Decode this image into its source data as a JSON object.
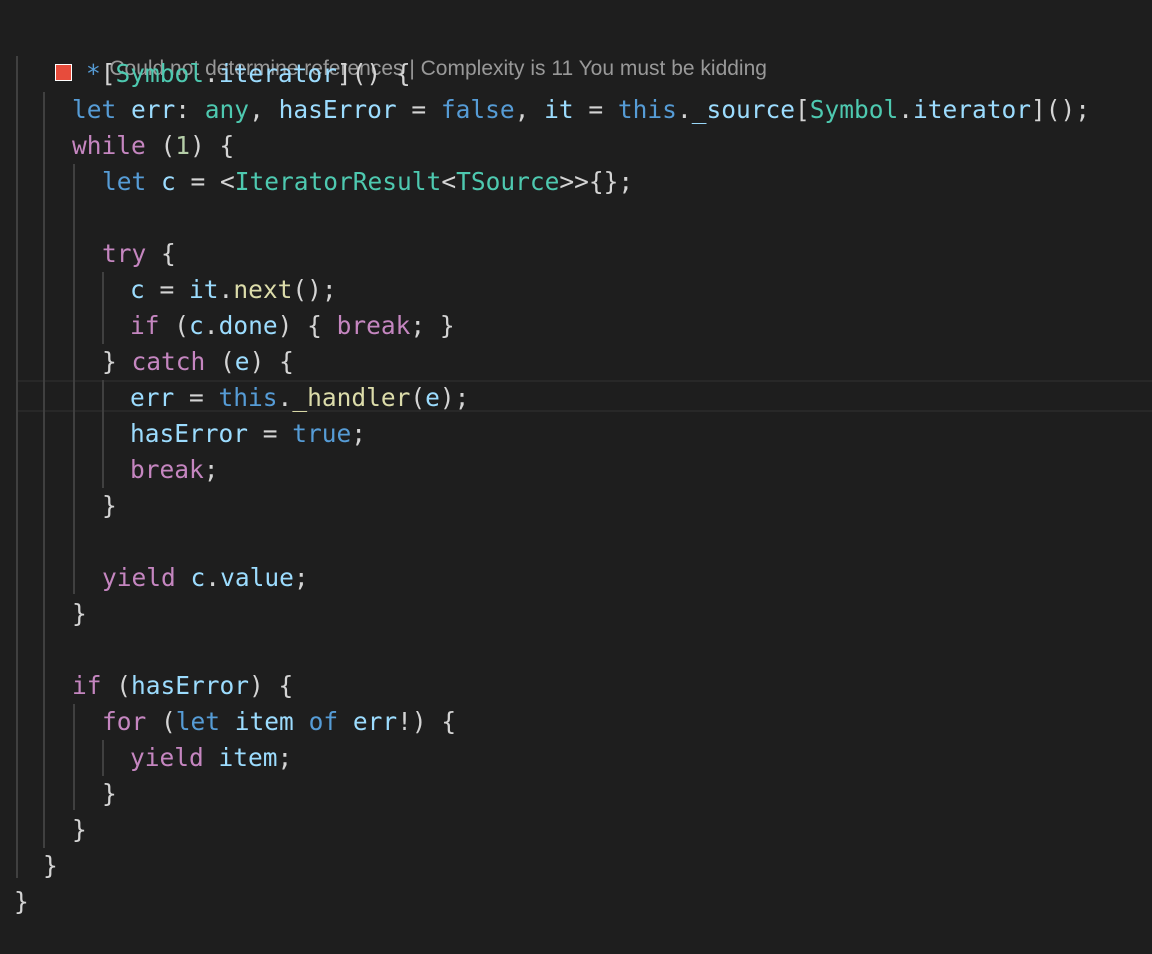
{
  "codelens": {
    "references": "Could not determine references",
    "separator": " | ",
    "complexity": "Complexity is 11 You must be kidding"
  },
  "breakpoint": {
    "color": "#e74c3c",
    "icon": "breakpoint-square"
  },
  "code_lines": [
    [
      {
        "t": "*",
        "c": "b"
      },
      {
        "t": "[",
        "c": "p"
      },
      {
        "t": "Symbol",
        "c": "t"
      },
      {
        "t": ".",
        "c": "p"
      },
      {
        "t": "iterator",
        "c": "v"
      },
      {
        "t": "]() {",
        "c": "p"
      }
    ],
    [
      {
        "t": "let ",
        "c": "b"
      },
      {
        "t": "err",
        "c": "v"
      },
      {
        "t": ": ",
        "c": "p"
      },
      {
        "t": "any",
        "c": "t"
      },
      {
        "t": ", ",
        "c": "p"
      },
      {
        "t": "hasError",
        "c": "v"
      },
      {
        "t": " = ",
        "c": "p"
      },
      {
        "t": "false",
        "c": "b"
      },
      {
        "t": ", ",
        "c": "p"
      },
      {
        "t": "it",
        "c": "v"
      },
      {
        "t": " = ",
        "c": "p"
      },
      {
        "t": "this",
        "c": "b"
      },
      {
        "t": ".",
        "c": "p"
      },
      {
        "t": "_source",
        "c": "v"
      },
      {
        "t": "[",
        "c": "p"
      },
      {
        "t": "Symbol",
        "c": "t"
      },
      {
        "t": ".",
        "c": "p"
      },
      {
        "t": "iterator",
        "c": "v"
      },
      {
        "t": "]();",
        "c": "p"
      }
    ],
    [
      {
        "t": "while",
        "c": "k"
      },
      {
        "t": " (",
        "c": "p"
      },
      {
        "t": "1",
        "c": "n"
      },
      {
        "t": ") {",
        "c": "p"
      }
    ],
    [
      {
        "t": "let ",
        "c": "b"
      },
      {
        "t": "c",
        "c": "v"
      },
      {
        "t": " = <",
        "c": "p"
      },
      {
        "t": "IteratorResult",
        "c": "t"
      },
      {
        "t": "<",
        "c": "p"
      },
      {
        "t": "TSource",
        "c": "t"
      },
      {
        "t": ">>{};",
        "c": "p"
      }
    ],
    [],
    [
      {
        "t": "try",
        "c": "k"
      },
      {
        "t": " {",
        "c": "p"
      }
    ],
    [
      {
        "t": "c",
        "c": "v"
      },
      {
        "t": " = ",
        "c": "p"
      },
      {
        "t": "it",
        "c": "v"
      },
      {
        "t": ".",
        "c": "p"
      },
      {
        "t": "next",
        "c": "f"
      },
      {
        "t": "();",
        "c": "p"
      }
    ],
    [
      {
        "t": "if",
        "c": "k"
      },
      {
        "t": " (",
        "c": "p"
      },
      {
        "t": "c",
        "c": "v"
      },
      {
        "t": ".",
        "c": "p"
      },
      {
        "t": "done",
        "c": "v"
      },
      {
        "t": ") { ",
        "c": "p"
      },
      {
        "t": "break",
        "c": "k"
      },
      {
        "t": "; }",
        "c": "p"
      }
    ],
    [
      {
        "t": "} ",
        "c": "p"
      },
      {
        "t": "catch",
        "c": "k"
      },
      {
        "t": " (",
        "c": "p"
      },
      {
        "t": "e",
        "c": "v"
      },
      {
        "t": ") {",
        "c": "p"
      }
    ],
    [
      {
        "t": "err",
        "c": "v"
      },
      {
        "t": " = ",
        "c": "p"
      },
      {
        "t": "this",
        "c": "b"
      },
      {
        "t": ".",
        "c": "p"
      },
      {
        "t": "_handler",
        "c": "f"
      },
      {
        "t": "(",
        "c": "p"
      },
      {
        "t": "e",
        "c": "v"
      },
      {
        "t": ");",
        "c": "p"
      }
    ],
    [
      {
        "t": "hasError",
        "c": "v"
      },
      {
        "t": " = ",
        "c": "p"
      },
      {
        "t": "true",
        "c": "b"
      },
      {
        "t": ";",
        "c": "p"
      }
    ],
    [
      {
        "t": "break",
        "c": "k"
      },
      {
        "t": ";",
        "c": "p"
      }
    ],
    [
      {
        "t": "}",
        "c": "p"
      }
    ],
    [],
    [
      {
        "t": "yield",
        "c": "k"
      },
      {
        "t": " ",
        "c": "p"
      },
      {
        "t": "c",
        "c": "v"
      },
      {
        "t": ".",
        "c": "p"
      },
      {
        "t": "value",
        "c": "v"
      },
      {
        "t": ";",
        "c": "p"
      }
    ],
    [
      {
        "t": "}",
        "c": "p"
      }
    ],
    [],
    [
      {
        "t": "if",
        "c": "k"
      },
      {
        "t": " (",
        "c": "p"
      },
      {
        "t": "hasError",
        "c": "v"
      },
      {
        "t": ") {",
        "c": "p"
      }
    ],
    [
      {
        "t": "for",
        "c": "k"
      },
      {
        "t": " (",
        "c": "p"
      },
      {
        "t": "let ",
        "c": "b"
      },
      {
        "t": "item",
        "c": "v"
      },
      {
        "t": " ",
        "c": "p"
      },
      {
        "t": "of",
        "c": "b"
      },
      {
        "t": " ",
        "c": "p"
      },
      {
        "t": "err",
        "c": "v"
      },
      {
        "t": "!) {",
        "c": "p"
      }
    ],
    [
      {
        "t": "yield",
        "c": "k"
      },
      {
        "t": " ",
        "c": "p"
      },
      {
        "t": "item",
        "c": "v"
      },
      {
        "t": ";",
        "c": "p"
      }
    ],
    [
      {
        "t": "}",
        "c": "p"
      }
    ],
    [
      {
        "t": "}",
        "c": "p"
      }
    ],
    [
      {
        "t": "}",
        "c": "p"
      }
    ],
    [
      {
        "t": "}",
        "c": "p"
      }
    ]
  ]
}
